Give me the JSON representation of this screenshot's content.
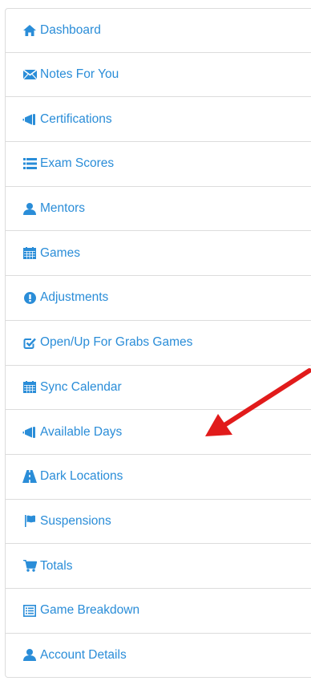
{
  "accent_color": "#2a8dd8",
  "annotation_arrow_color": "#e11b1b",
  "nav": {
    "items": [
      {
        "label": "Dashboard",
        "icon": "home-icon"
      },
      {
        "label": "Notes For You",
        "icon": "envelope-icon"
      },
      {
        "label": "Certifications",
        "icon": "bullhorn-icon"
      },
      {
        "label": "Exam Scores",
        "icon": "list-icon"
      },
      {
        "label": "Mentors",
        "icon": "user-icon"
      },
      {
        "label": "Games",
        "icon": "calendar-icon"
      },
      {
        "label": "Adjustments",
        "icon": "exclamation-circle-icon"
      },
      {
        "label": "Open/Up For Grabs Games",
        "icon": "check-square-icon"
      },
      {
        "label": "Sync Calendar",
        "icon": "calendar-icon"
      },
      {
        "label": "Available Days",
        "icon": "bullhorn-icon"
      },
      {
        "label": "Dark Locations",
        "icon": "road-icon"
      },
      {
        "label": "Suspensions",
        "icon": "flag-icon"
      },
      {
        "label": "Totals",
        "icon": "shopping-cart-icon"
      },
      {
        "label": "Game Breakdown",
        "icon": "list-alt-icon"
      },
      {
        "label": "Account Details",
        "icon": "user-icon"
      }
    ]
  }
}
